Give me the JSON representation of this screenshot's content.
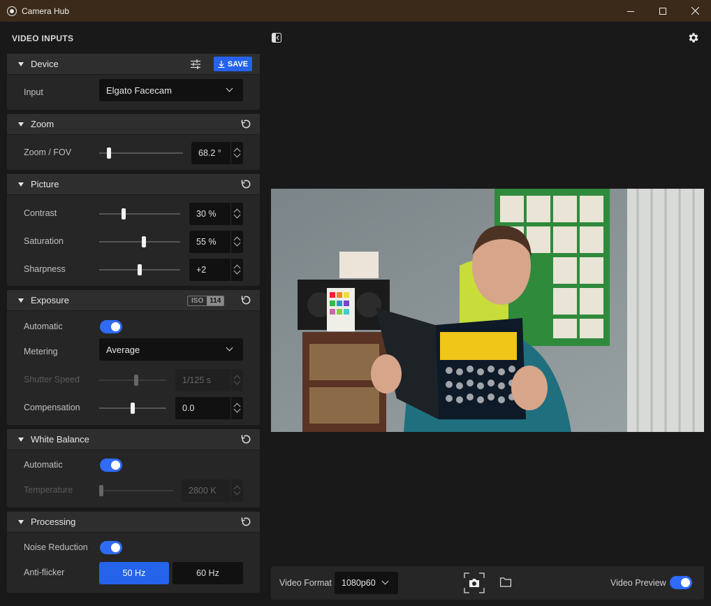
{
  "window": {
    "title": "Camera Hub"
  },
  "sidebar": {
    "title": "VIDEO INPUTS",
    "device": {
      "title": "Device",
      "save_label": "SAVE",
      "input_label": "Input",
      "input_value": "Elgato Facecam"
    },
    "zoom": {
      "title": "Zoom",
      "fov_label": "Zoom / FOV",
      "fov_value": "68.2 °",
      "fov_level": 0.12
    },
    "picture": {
      "title": "Picture",
      "contrast": {
        "label": "Contrast",
        "value": "30 %",
        "level": 0.3
      },
      "saturation": {
        "label": "Saturation",
        "value": "55 %",
        "level": 0.55
      },
      "sharpness": {
        "label": "Sharpness",
        "value": "+2",
        "level": 0.5
      }
    },
    "exposure": {
      "title": "Exposure",
      "iso_label": "ISO",
      "iso_value": "114",
      "automatic_label": "Automatic",
      "automatic_on": true,
      "metering_label": "Metering",
      "metering_value": "Average",
      "shutter": {
        "label": "Shutter Speed",
        "value": "1/125 s",
        "level": 0.55,
        "disabled": true
      },
      "compensation": {
        "label": "Compensation",
        "value": "0.0",
        "level": 0.5
      }
    },
    "white_balance": {
      "title": "White Balance",
      "automatic_label": "Automatic",
      "automatic_on": true,
      "temperature": {
        "label": "Temperature",
        "value": "2800 K",
        "level": 0.0,
        "disabled": true
      }
    },
    "processing": {
      "title": "Processing",
      "noise_label": "Noise Reduction",
      "noise_on": true,
      "antiflicker_label": "Anti-flicker",
      "options": [
        "50 Hz",
        "60 Hz"
      ],
      "selected": "50 Hz"
    }
  },
  "bottom_bar": {
    "video_format_label": "Video Format",
    "video_format_value": "1080p60",
    "video_preview_label": "Video Preview",
    "video_preview_on": true
  },
  "colors": {
    "accent": "#2f6bf7",
    "save": "#2563eb",
    "titlebar": "#3b2a1a"
  }
}
